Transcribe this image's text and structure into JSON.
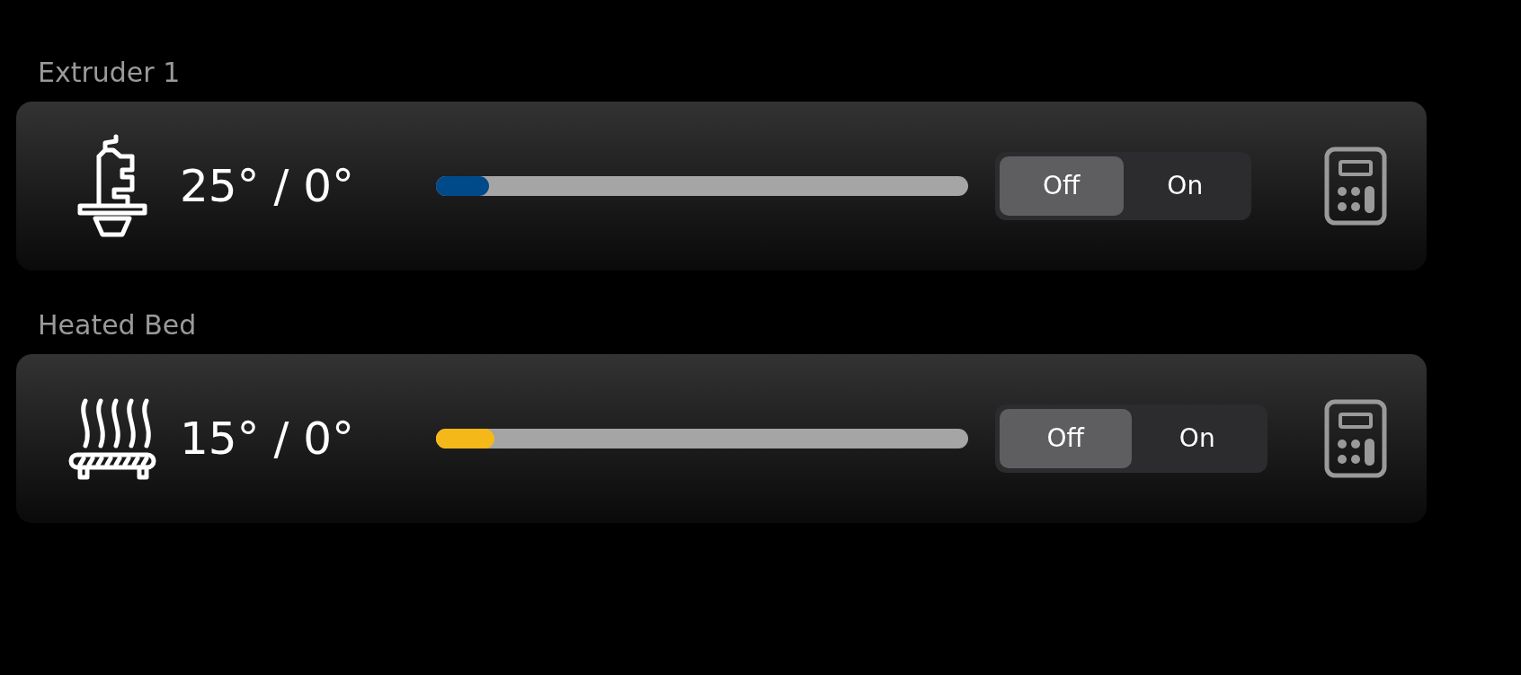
{
  "heaters": [
    {
      "kind": "extruder",
      "label": "Extruder 1",
      "reading": "25° / 0°",
      "level": 0.1,
      "color": "#004a8a",
      "options": [
        {
          "label": "Off",
          "selected": true
        },
        {
          "label": "On",
          "selected": false
        }
      ]
    },
    {
      "kind": "bed",
      "label": "Heated Bed",
      "reading": "15° / 0°",
      "level": 0.11,
      "color": "#f5b819",
      "options": [
        {
          "label": "Off",
          "selected": true
        },
        {
          "label": "On",
          "selected": false
        }
      ]
    }
  ]
}
